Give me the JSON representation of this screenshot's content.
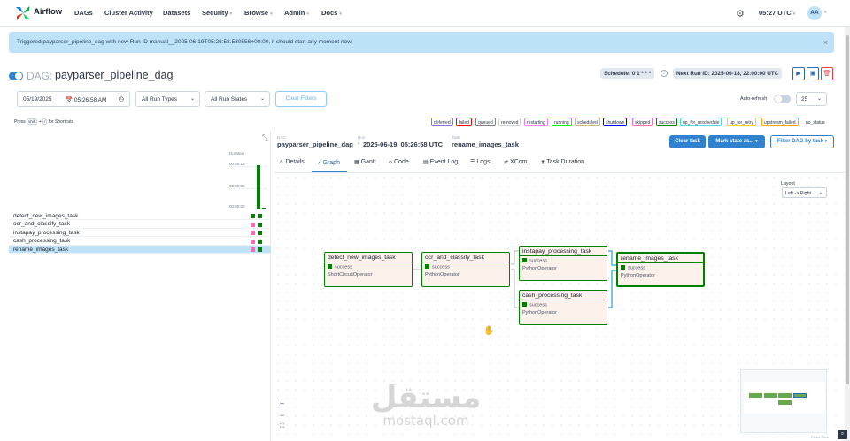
{
  "nav": {
    "brand": "Airflow",
    "items": [
      {
        "label": "DAGs",
        "caret": false
      },
      {
        "label": "Cluster Activity",
        "caret": false
      },
      {
        "label": "Datasets",
        "caret": false
      },
      {
        "label": "Security",
        "caret": true
      },
      {
        "label": "Browse",
        "caret": true
      },
      {
        "label": "Admin",
        "caret": true
      },
      {
        "label": "Docs",
        "caret": true
      }
    ],
    "time": "05:27 UTC",
    "avatar": "AA"
  },
  "alert": {
    "message": "Triggered payparser_pipeline_dag with new Run ID manual__2025-06-19T05:26:58.530556+00:00, it should start any moment now.",
    "close": "×"
  },
  "dag": {
    "prefix": "DAG:",
    "name": "payparser_pipeline_dag",
    "schedule": "Schedule: 0 1 * * *",
    "next_run": "Next Run ID: 2025-06-18, 22:00:00 UTC"
  },
  "filters": {
    "date": "05/19/2025",
    "time": "05:26:58 AM",
    "run_types": "All Run Types",
    "run_states": "All Run States",
    "clear": "Clear Filters",
    "auto_refresh": "Auto-refresh",
    "num_runs": "25"
  },
  "shortcuts": {
    "pre": "Press",
    "key1": "shift",
    "plus": "+",
    "key2": "/",
    "post": "for Shortcuts"
  },
  "legend": [
    {
      "label": "deferred",
      "color": "#9370db"
    },
    {
      "label": "failed",
      "color": "#ff0000"
    },
    {
      "label": "queued",
      "color": "#808080"
    },
    {
      "label": "removed",
      "color": "#d3d3d3"
    },
    {
      "label": "restarting",
      "color": "#ee82ee"
    },
    {
      "label": "running",
      "color": "#00ff00"
    },
    {
      "label": "scheduled",
      "color": "#d2b48c"
    },
    {
      "label": "shutdown",
      "color": "#0000ff"
    },
    {
      "label": "skipped",
      "color": "#ff69b4"
    },
    {
      "label": "success",
      "color": "#008000"
    },
    {
      "label": "up_for_reschedule",
      "color": "#40e0d0"
    },
    {
      "label": "up_for_retry",
      "color": "#ffd700"
    },
    {
      "label": "upstream_failed",
      "color": "#ffa500"
    },
    {
      "label": "no_status",
      "color": "#ffffff"
    }
  ],
  "grid": {
    "duration_label": "Duration",
    "ticks": [
      "00:00:13",
      "00:00:06",
      "00:00:00"
    ],
    "run_durations_sec": [
      13,
      0.5
    ],
    "tasks": [
      {
        "name": "detect_new_images_task",
        "states": [
          "success",
          "success"
        ]
      },
      {
        "name": "ocr_and_classify_task",
        "states": [
          "skipped",
          "success"
        ]
      },
      {
        "name": "instapay_processing_task",
        "states": [
          "skipped",
          "success"
        ]
      },
      {
        "name": "cash_processing_task",
        "states": [
          "skipped",
          "success"
        ]
      },
      {
        "name": "rename_images_task",
        "states": [
          "skipped",
          "success"
        ]
      }
    ]
  },
  "details": {
    "bc_dag_label": "DAG",
    "bc_run_label": "Run",
    "bc_task_label": "Task",
    "dag": "payparser_pipeline_dag",
    "run": "2025-06-19, 05:26:58 UTC",
    "task": "rename_images_task",
    "clear_task": "Clear task",
    "mark_state": "Mark state as...",
    "filter_dag": "Filter DAG by task"
  },
  "tabs": [
    {
      "label": "Details",
      "icon": "info-icon",
      "glyph": "⚠"
    },
    {
      "label": "Graph",
      "icon": "graph-icon",
      "glyph": "⸙"
    },
    {
      "label": "Gantt",
      "icon": "gantt-icon",
      "glyph": "▦"
    },
    {
      "label": "Code",
      "icon": "code-icon",
      "glyph": "‹›"
    },
    {
      "label": "Event Log",
      "icon": "event-log-icon",
      "glyph": "▤"
    },
    {
      "label": "Logs",
      "icon": "logs-icon",
      "glyph": "☰"
    },
    {
      "label": "XCom",
      "icon": "xcom-icon",
      "glyph": "⇄"
    },
    {
      "label": "Task Duration",
      "icon": "hourglass-icon",
      "glyph": "⧗"
    }
  ],
  "active_tab": "Graph",
  "graph": {
    "layout_label": "Layout",
    "layout_value": "Left -> Right",
    "nodes": [
      {
        "name": "detect_new_images_task",
        "status": "success",
        "operator": "ShortCircuitOperator"
      },
      {
        "name": "ocr_and_classify_task",
        "status": "success",
        "operator": "PythonOperator"
      },
      {
        "name": "instapay_processing_task",
        "status": "success",
        "operator": "PythonOperator"
      },
      {
        "name": "cash_processing_task",
        "status": "success",
        "operator": "PythonOperator"
      },
      {
        "name": "rename_images_task",
        "status": "success",
        "operator": "PythonOperator"
      }
    ],
    "zoom_in": "+",
    "zoom_out": "−",
    "fit": "⛶",
    "attribution": "React Flow"
  },
  "watermark": {
    "arabic": "مستقل",
    "latin": "mostaql.com"
  },
  "colors": {
    "success": "#008000",
    "skipped": "#ff69b4",
    "accent": "#3182ce",
    "alert_bg": "#bee3f8"
  }
}
